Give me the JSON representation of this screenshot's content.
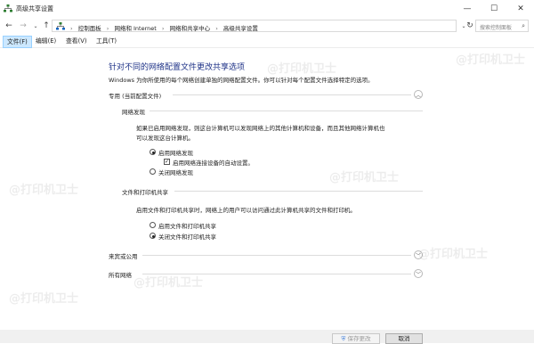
{
  "window": {
    "title": "高级共享设置",
    "minimize_glyph": "—",
    "maximize_glyph": "☐",
    "close_glyph": "✕"
  },
  "address": {
    "crumbs": [
      "控制面板",
      "网络和 Internet",
      "网络和共享中心",
      "高级共享设置"
    ],
    "search_placeholder": "搜索控制面板"
  },
  "menu": {
    "items": [
      "文件(F)",
      "编辑(E)",
      "查看(V)",
      "工具(T)"
    ],
    "active_index": 0
  },
  "main": {
    "heading": "针对不同的网络配置文件更改共享选项",
    "description": "Windows 为你所使用的每个网络创建单独的网络配置文件。你可以针对每个配置文件选择特定的选项。",
    "profile_private": {
      "label": "专用 (当前配置文件)",
      "expanded": true,
      "network_discovery": {
        "title": "网络发现",
        "description_line1": "如果已启用网络发现，则这台计算机可以发现网络上的其他计算机和设备，而且其他网络计算机也",
        "description_line2": "可以发现这台计算机。",
        "option_on": "启用网络发现",
        "option_auto": "启用网络连接设备的自动设置。",
        "option_off": "关闭网络发现",
        "selected": "on",
        "auto_checked": true
      },
      "file_printer_sharing": {
        "title": "文件和打印机共享",
        "description": "启用文件和打印机共享时，网络上的用户可以访问通过此计算机共享的文件和打印机。",
        "option_on": "启用文件和打印机共享",
        "option_off": "关闭文件和打印机共享",
        "selected": "off"
      }
    },
    "profile_guest": {
      "label": "来宾或公用",
      "expanded": false
    },
    "profile_all": {
      "label": "所有网络",
      "expanded": false
    }
  },
  "footer": {
    "save_label": "保存更改",
    "cancel_label": "取消"
  },
  "watermark": {
    "text": "@打印机卫士"
  }
}
